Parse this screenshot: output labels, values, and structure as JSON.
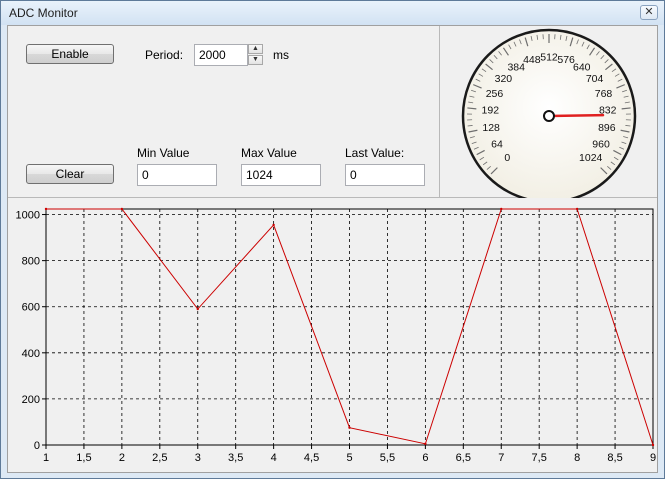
{
  "window": {
    "title": "ADC Monitor",
    "close_glyph": "✕"
  },
  "controls": {
    "enable_label": "Enable",
    "clear_label": "Clear",
    "period_label": "Period:",
    "period_value": "2000",
    "period_unit": "ms",
    "min_label": "Min Value",
    "min_value": "0",
    "max_label": "Max Value",
    "max_value": "1024",
    "last_label": "Last Value:",
    "last_value": "0"
  },
  "gauge": {
    "min": 0,
    "max": 1024,
    "labels": [
      "0",
      "64",
      "128",
      "192",
      "256",
      "320",
      "384",
      "448",
      "512",
      "576",
      "640",
      "704",
      "768",
      "832",
      "896",
      "960",
      "1024"
    ],
    "needle_value": 850,
    "needle_color": "#e02020"
  },
  "chart_data": {
    "type": "line",
    "x": [
      1,
      2,
      3,
      4,
      5,
      6,
      7,
      8,
      9
    ],
    "series": [
      {
        "values": [
          1024,
          1024,
          590,
          955,
          75,
          5,
          1024,
          1024,
          0
        ],
        "color": "#cc0000"
      }
    ],
    "x_ticks": [
      "1",
      "1,5",
      "2",
      "2,5",
      "3",
      "3,5",
      "4",
      "4,5",
      "5",
      "5,5",
      "6",
      "6,5",
      "7",
      "7,5",
      "8",
      "8,5",
      "9"
    ],
    "y_ticks": [
      "0",
      "200",
      "400",
      "600",
      "800",
      "1000"
    ],
    "xlim": [
      1,
      9
    ],
    "ylim": [
      0,
      1024
    ],
    "grid": true
  }
}
